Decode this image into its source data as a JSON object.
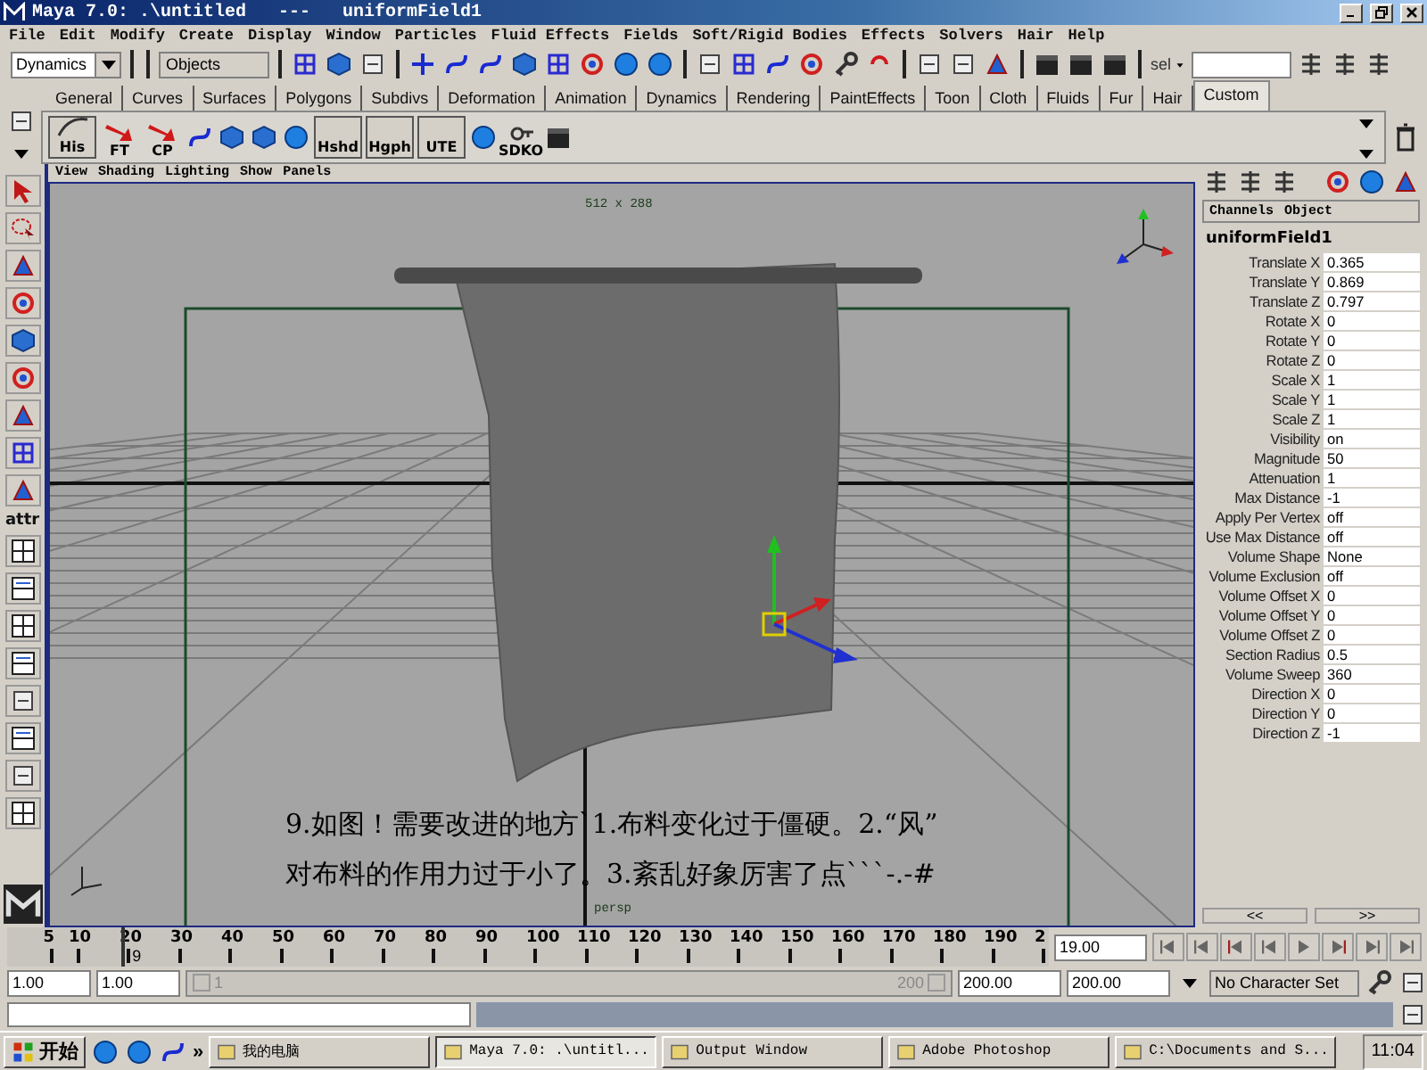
{
  "window": {
    "title": "Maya 7.0: .\\untitled   ---   uniformField1"
  },
  "menu_bar": [
    "File",
    "Edit",
    "Modify",
    "Create",
    "Display",
    "Window",
    "Particles",
    "Fluid Effects",
    "Fields",
    "Soft/Rigid Bodies",
    "Effects",
    "Solvers",
    "Hair",
    "Help"
  ],
  "status_line": {
    "menu_set": "Dynamics",
    "selection_mode": "Objects",
    "quick_select_label": "sel"
  },
  "shelf_tabs": [
    {
      "label": "General",
      "selected": false
    },
    {
      "label": "Curves",
      "selected": false
    },
    {
      "label": "Surfaces",
      "selected": false
    },
    {
      "label": "Polygons",
      "selected": false
    },
    {
      "label": "Subdivs",
      "selected": false
    },
    {
      "label": "Deformation",
      "selected": false
    },
    {
      "label": "Animation",
      "selected": false
    },
    {
      "label": "Dynamics",
      "selected": false
    },
    {
      "label": "Rendering",
      "selected": false
    },
    {
      "label": "PaintEffects",
      "selected": false
    },
    {
      "label": "Toon",
      "selected": false
    },
    {
      "label": "Cloth",
      "selected": false
    },
    {
      "label": "Fluids",
      "selected": false
    },
    {
      "label": "Fur",
      "selected": false
    },
    {
      "label": "Hair",
      "selected": false
    },
    {
      "label": "Custom",
      "selected": true
    }
  ],
  "shelf_labels": [
    "His",
    "FT",
    "CP",
    "Hshd",
    "Hgph",
    "UTE",
    "SDKO"
  ],
  "panel_menu": [
    "View",
    "Shading",
    "Lighting",
    "Show",
    "Panels"
  ],
  "viewport": {
    "resolution": "512 x 288",
    "camera": "persp",
    "caption": [
      "9.如图！需要改进的地方`1.布料变化过于僵硬。2.“风”",
      "对布料的作用力过于小了。3.紊乱好象厉害了点```-.-#"
    ]
  },
  "toolbox": {
    "label": "attr"
  },
  "channel_box": {
    "menu": [
      "Channels",
      "Object"
    ],
    "node": "uniformField1",
    "attributes": [
      {
        "name": "Translate X",
        "value": "0.365"
      },
      {
        "name": "Translate Y",
        "value": "0.869"
      },
      {
        "name": "Translate Z",
        "value": "0.797"
      },
      {
        "name": "Rotate X",
        "value": "0"
      },
      {
        "name": "Rotate Y",
        "value": "0"
      },
      {
        "name": "Rotate Z",
        "value": "0"
      },
      {
        "name": "Scale X",
        "value": "1"
      },
      {
        "name": "Scale Y",
        "value": "1"
      },
      {
        "name": "Scale Z",
        "value": "1"
      },
      {
        "name": "Visibility",
        "value": "on"
      },
      {
        "name": "Magnitude",
        "value": "50"
      },
      {
        "name": "Attenuation",
        "value": "1"
      },
      {
        "name": "Max Distance",
        "value": "-1"
      },
      {
        "name": "Apply Per Vertex",
        "value": "off"
      },
      {
        "name": "Use Max Distance",
        "value": "off"
      },
      {
        "name": "Volume Shape",
        "value": "None"
      },
      {
        "name": "Volume Exclusion",
        "value": "off"
      },
      {
        "name": "Volume Offset X",
        "value": "0"
      },
      {
        "name": "Volume Offset Y",
        "value": "0"
      },
      {
        "name": "Volume Offset Z",
        "value": "0"
      },
      {
        "name": "Section Radius",
        "value": "0.5"
      },
      {
        "name": "Volume Sweep",
        "value": "360"
      },
      {
        "name": "Direction X",
        "value": "0"
      },
      {
        "name": "Direction Y",
        "value": "0"
      },
      {
        "name": "Direction Z",
        "value": "-1"
      }
    ]
  },
  "layer_buttons": [
    "<<",
    ">>"
  ],
  "time_slider": {
    "ticks": [
      "5",
      "10",
      "20",
      "30",
      "40",
      "50",
      "60",
      "70",
      "80",
      "90",
      "100",
      "110",
      "120",
      "130",
      "140",
      "150",
      "160",
      "170",
      "180",
      "190",
      "2"
    ],
    "current_frame": "9",
    "current_time": "19.00",
    "level": 0.095
  },
  "range_slider": {
    "level": 1,
    "start_time": "1.00",
    "playback_start": "1.00",
    "range_start": "1",
    "range_end": "200",
    "playback_end": "200.00",
    "end_time": "200.00",
    "character_set": "No Character Set"
  },
  "taskbar": {
    "start": "开始",
    "more": "»",
    "items": [
      {
        "label": "我的电脑",
        "selected": false
      },
      {
        "label": "Maya 7.0: .\\untitl...",
        "selected": true
      },
      {
        "label": "Output Window",
        "selected": false
      },
      {
        "label": "Adobe Photoshop",
        "selected": false
      },
      {
        "label": "C:\\Documents and S...",
        "selected": false
      }
    ],
    "clock": "11:04"
  }
}
